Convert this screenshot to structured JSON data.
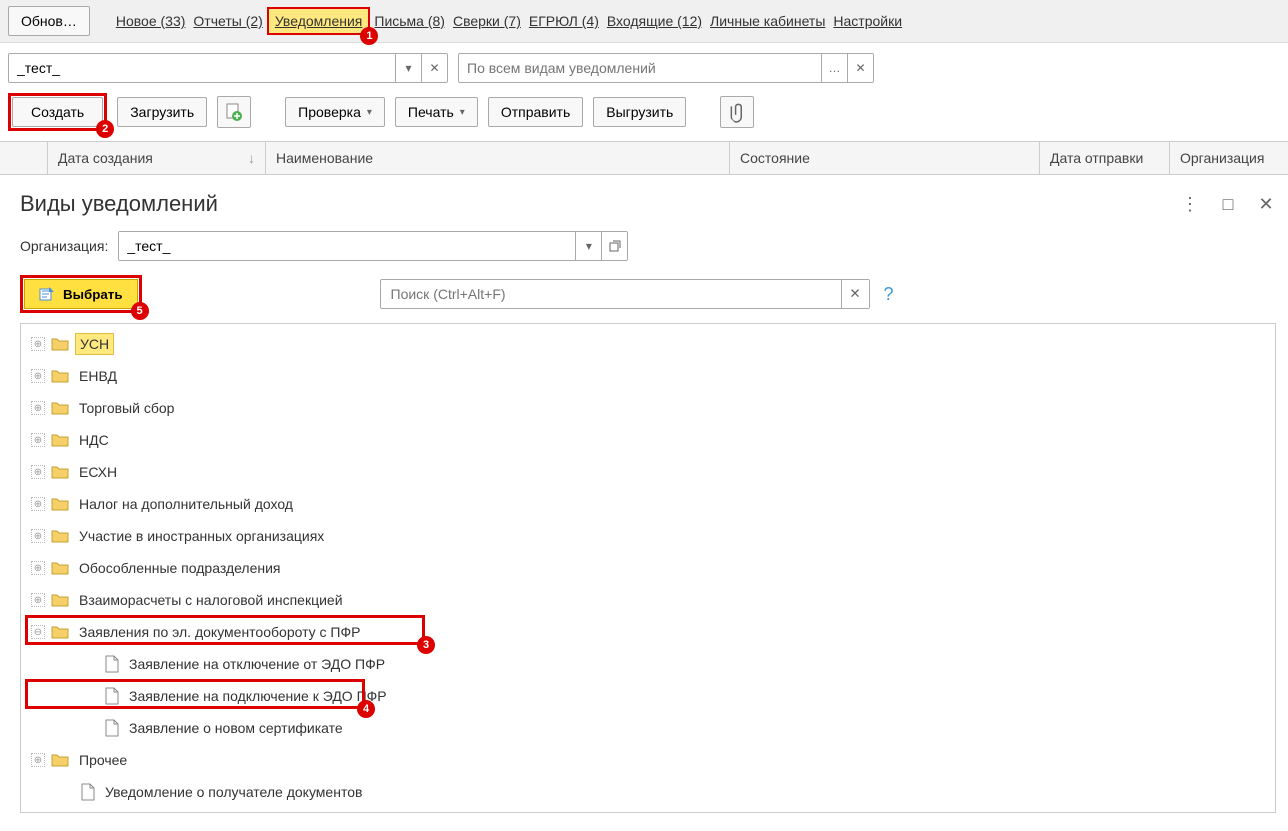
{
  "nav": {
    "update_btn": "Обнов…",
    "links": [
      {
        "id": "new",
        "label": "Новое (33)"
      },
      {
        "id": "reports",
        "label": "Отчеты (2)"
      },
      {
        "id": "notifications",
        "label": "Уведомления",
        "active": true,
        "callout": "1"
      },
      {
        "id": "letters",
        "label": "Письма (8)"
      },
      {
        "id": "reconcile",
        "label": "Сверки (7)"
      },
      {
        "id": "egrul",
        "label": "ЕГРЮЛ (4)"
      },
      {
        "id": "inbox",
        "label": "Входящие (12)"
      },
      {
        "id": "cabinets",
        "label": "Личные кабинеты"
      },
      {
        "id": "settings",
        "label": "Настройки"
      }
    ]
  },
  "filter": {
    "org_value": "_тест_",
    "type_placeholder": "По всем видам уведомлений"
  },
  "toolbar": {
    "create": "Создать",
    "create_callout": "2",
    "load": "Загрузить",
    "check": "Проверка",
    "print": "Печать",
    "send": "Отправить",
    "export": "Выгрузить"
  },
  "table_headers": {
    "date_created": "Дата создания",
    "name": "Наименование",
    "state": "Состояние",
    "date_sent": "Дата отправки",
    "org": "Организация"
  },
  "dialog": {
    "title": "Виды уведомлений",
    "org_label": "Организация:",
    "org_value": "_тест_",
    "select_btn": "Выбрать",
    "select_callout": "5",
    "search_placeholder": "Поиск (Ctrl+Alt+F)"
  },
  "tree": [
    {
      "type": "folder",
      "exp": "+",
      "label": "УСН",
      "hl": true
    },
    {
      "type": "folder",
      "exp": "+",
      "label": "ЕНВД"
    },
    {
      "type": "folder",
      "exp": "+",
      "label": "Торговый сбор"
    },
    {
      "type": "folder",
      "exp": "+",
      "label": "НДС"
    },
    {
      "type": "folder",
      "exp": "+",
      "label": "ЕСХН"
    },
    {
      "type": "folder",
      "exp": "+",
      "label": "Налог на дополнительный доход"
    },
    {
      "type": "folder",
      "exp": "+",
      "label": "Участие в иностранных организациях"
    },
    {
      "type": "folder",
      "exp": "+",
      "label": "Обособленные подразделения"
    },
    {
      "type": "folder",
      "exp": "+",
      "label": "Взаиморасчеты с налоговой инспекцией"
    },
    {
      "type": "folder",
      "exp": "-",
      "label": "Заявления по эл. документообороту с ПФР",
      "box": true,
      "callout": "3"
    },
    {
      "type": "doc",
      "indent": 1,
      "label": "Заявление на отключение от ЭДО ПФР"
    },
    {
      "type": "doc",
      "indent": 1,
      "label": "Заявление на подключение к ЭДО ПФР",
      "box": true,
      "callout": "4"
    },
    {
      "type": "doc",
      "indent": 1,
      "label": "Заявление о новом сертификате"
    },
    {
      "type": "folder",
      "exp": "+",
      "label": "Прочее"
    },
    {
      "type": "doc",
      "indent": 0,
      "label": "Уведомление о получателе документов"
    }
  ]
}
